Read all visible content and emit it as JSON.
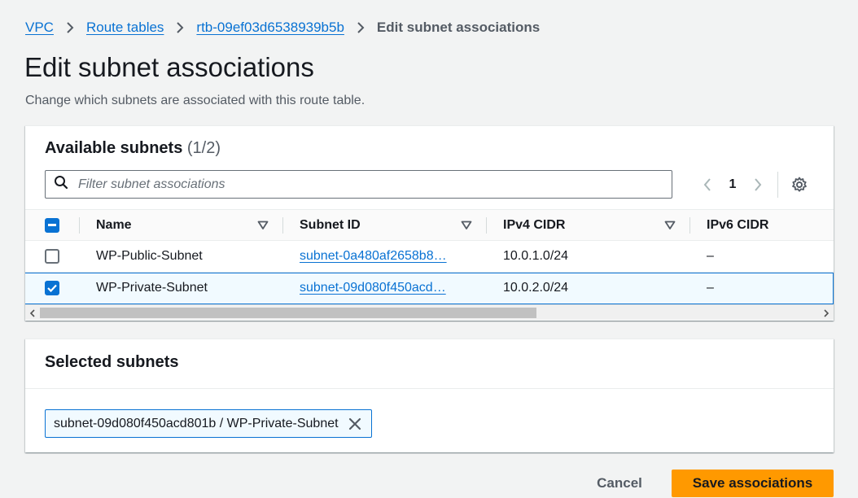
{
  "breadcrumb": {
    "items": [
      "VPC",
      "Route tables",
      "rtb-09ef03d6538939b5b"
    ],
    "current": "Edit subnet associations"
  },
  "page": {
    "title": "Edit subnet associations",
    "description": "Change which subnets are associated with this route table."
  },
  "available": {
    "title": "Available subnets",
    "count": "(1/2)",
    "filter_placeholder": "Filter subnet associations",
    "page": "1",
    "columns": [
      "Name",
      "Subnet ID",
      "IPv4 CIDR",
      "IPv6 CIDR"
    ],
    "rows": [
      {
        "selected": false,
        "name": "WP-Public-Subnet",
        "subnet_id": "subnet-0a480af2658b8…",
        "ipv4": "10.0.1.0/24",
        "ipv6": "–"
      },
      {
        "selected": true,
        "name": "WP-Private-Subnet",
        "subnet_id": "subnet-09d080f450acd…",
        "ipv4": "10.0.2.0/24",
        "ipv6": "–"
      }
    ],
    "header_checkbox": "indeterminate"
  },
  "selected": {
    "title": "Selected subnets",
    "tokens": [
      "subnet-09d080f450acd801b / WP-Private-Subnet"
    ]
  },
  "actions": {
    "cancel": "Cancel",
    "save": "Save associations"
  },
  "colors": {
    "link": "#0972d3",
    "primary_button": "#ff9900",
    "selected_row_bg": "#f1faff"
  },
  "icons": {
    "breadcrumb_separator": "chevron-right-icon",
    "search": "search-icon",
    "settings": "gear-icon",
    "sort": "caret-down-icon",
    "remove_token": "close-icon"
  }
}
